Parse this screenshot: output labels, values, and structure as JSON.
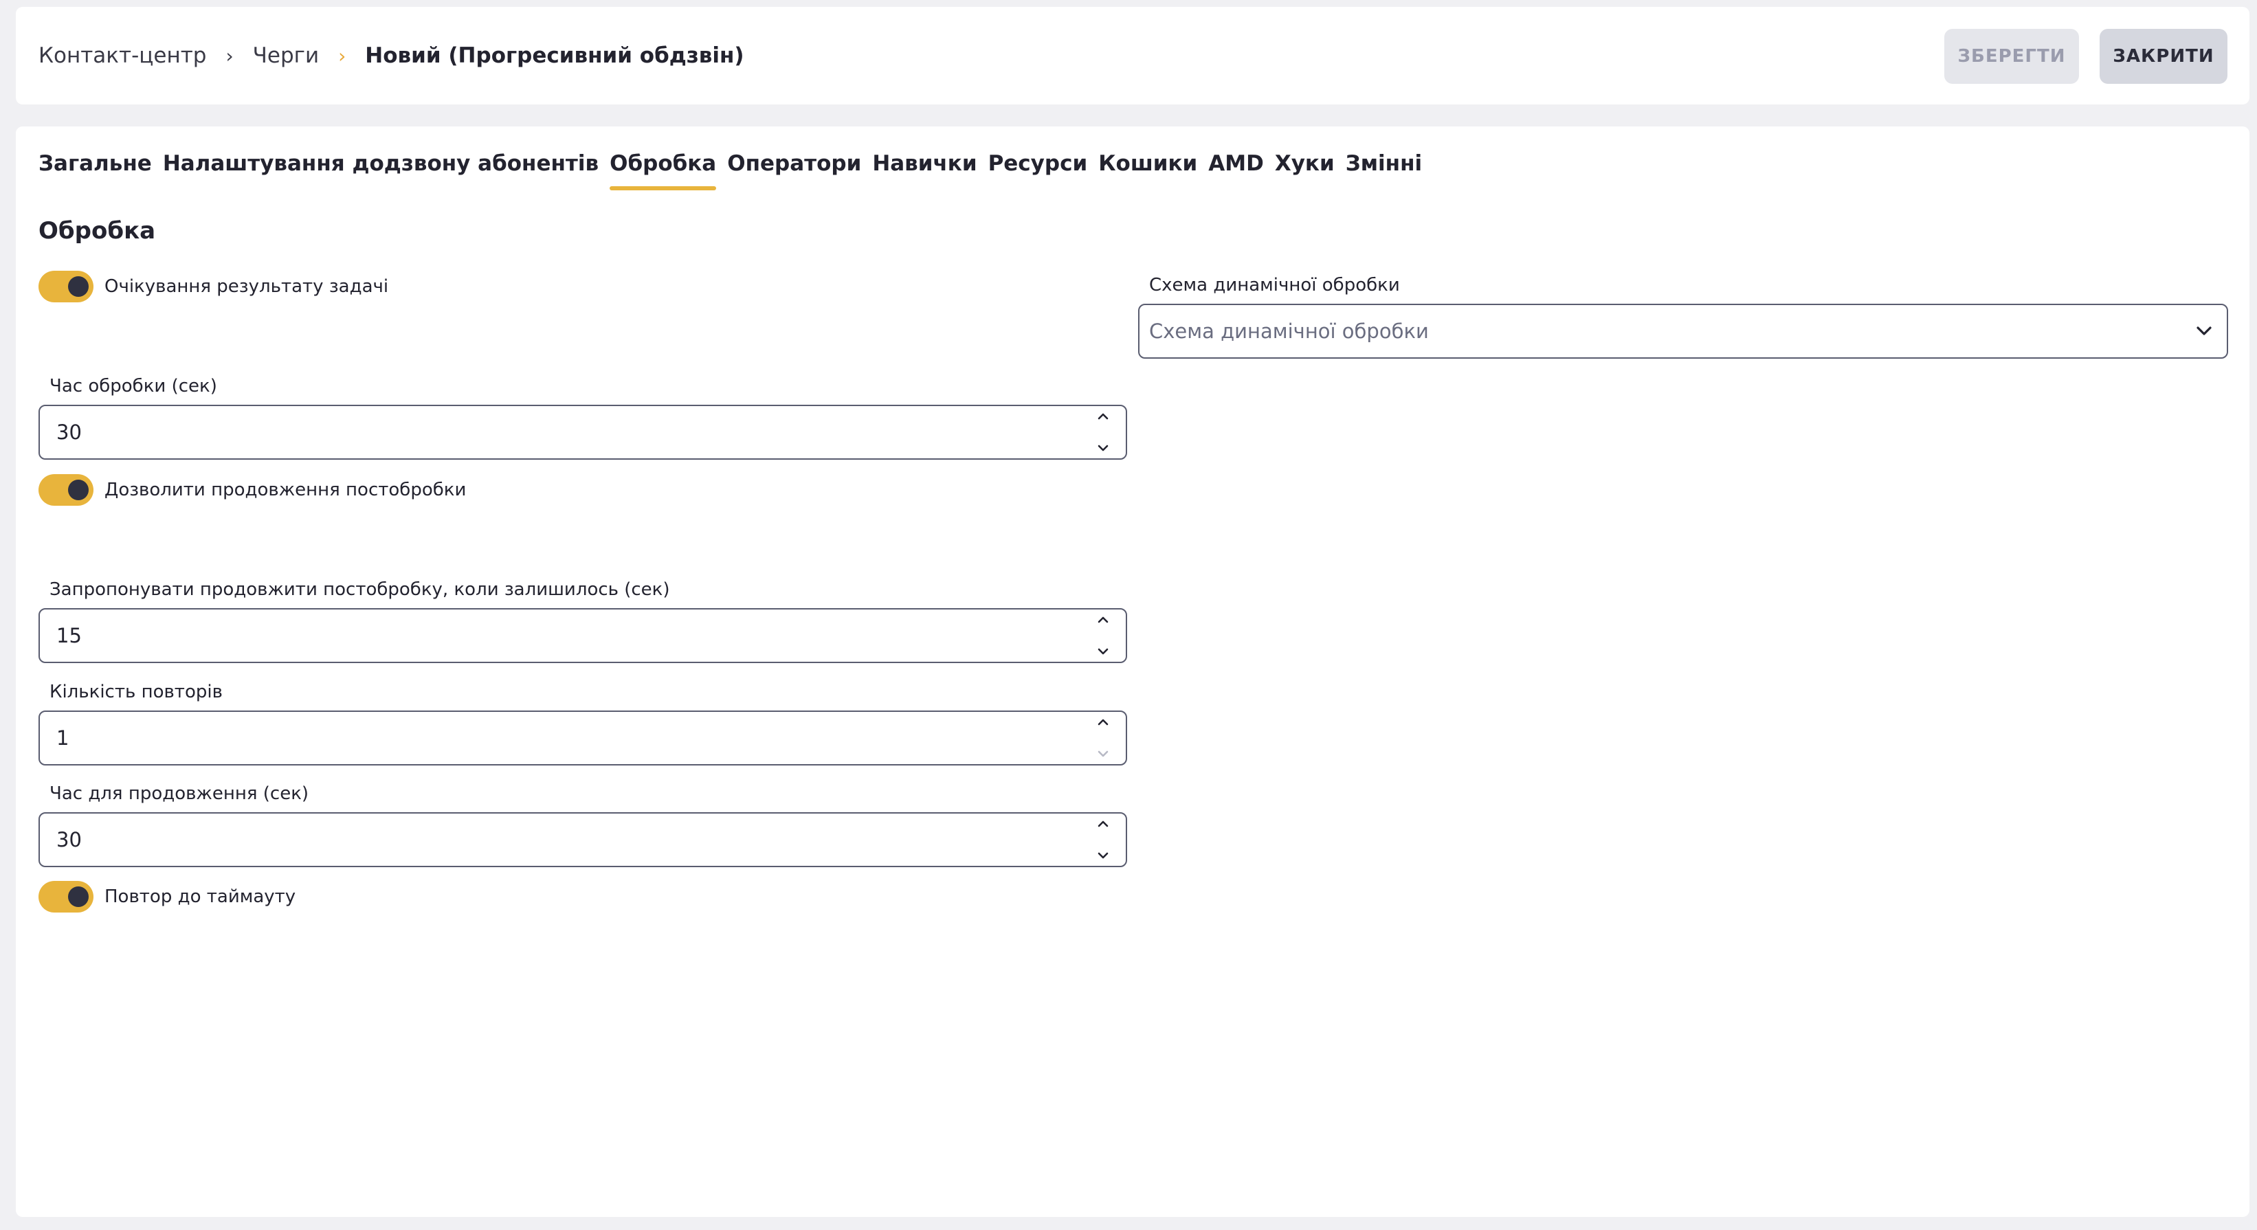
{
  "breadcrumb": {
    "items": [
      "Контакт-центр",
      "Черги",
      "Новий (Прогресивний обдзвін)"
    ]
  },
  "header": {
    "save_label": "ЗБЕРЕГТИ",
    "close_label": "ЗАКРИТИ"
  },
  "tabs": [
    {
      "label": "Загальне"
    },
    {
      "label": "Налаштування додзвону абонентів"
    },
    {
      "label": "Обробка",
      "active": true
    },
    {
      "label": "Оператори"
    },
    {
      "label": "Навички"
    },
    {
      "label": "Ресурси"
    },
    {
      "label": "Кошики"
    },
    {
      "label": "AMD"
    },
    {
      "label": "Хуки"
    },
    {
      "label": "Змінні"
    }
  ],
  "section": {
    "title": "Обробка"
  },
  "form": {
    "wait_result": {
      "label": "Очікування результату задачі",
      "enabled": true
    },
    "dynamic_schema": {
      "label": "Схема динамічної обробки",
      "placeholder": "Схема динамічної обробки"
    },
    "processing_time": {
      "label": "Час обробки (сек)",
      "value": "30"
    },
    "allow_extend": {
      "label": "Дозволити продовження постобробки",
      "enabled": true
    },
    "offer_extend": {
      "label": "Запропонувати продовжити постобробку, коли залишилось (сек)",
      "value": "15"
    },
    "repeat_count": {
      "label": "Кількість повторів",
      "value": "1"
    },
    "extend_time": {
      "label": "Час для продовження (сек)",
      "value": "30"
    },
    "repeat_until_timeout": {
      "label": "Повтор до таймауту",
      "enabled": true
    }
  },
  "colors": {
    "accent": "#e8b43c",
    "knob": "#2f3140",
    "page_bg": "#f0f0f3"
  }
}
